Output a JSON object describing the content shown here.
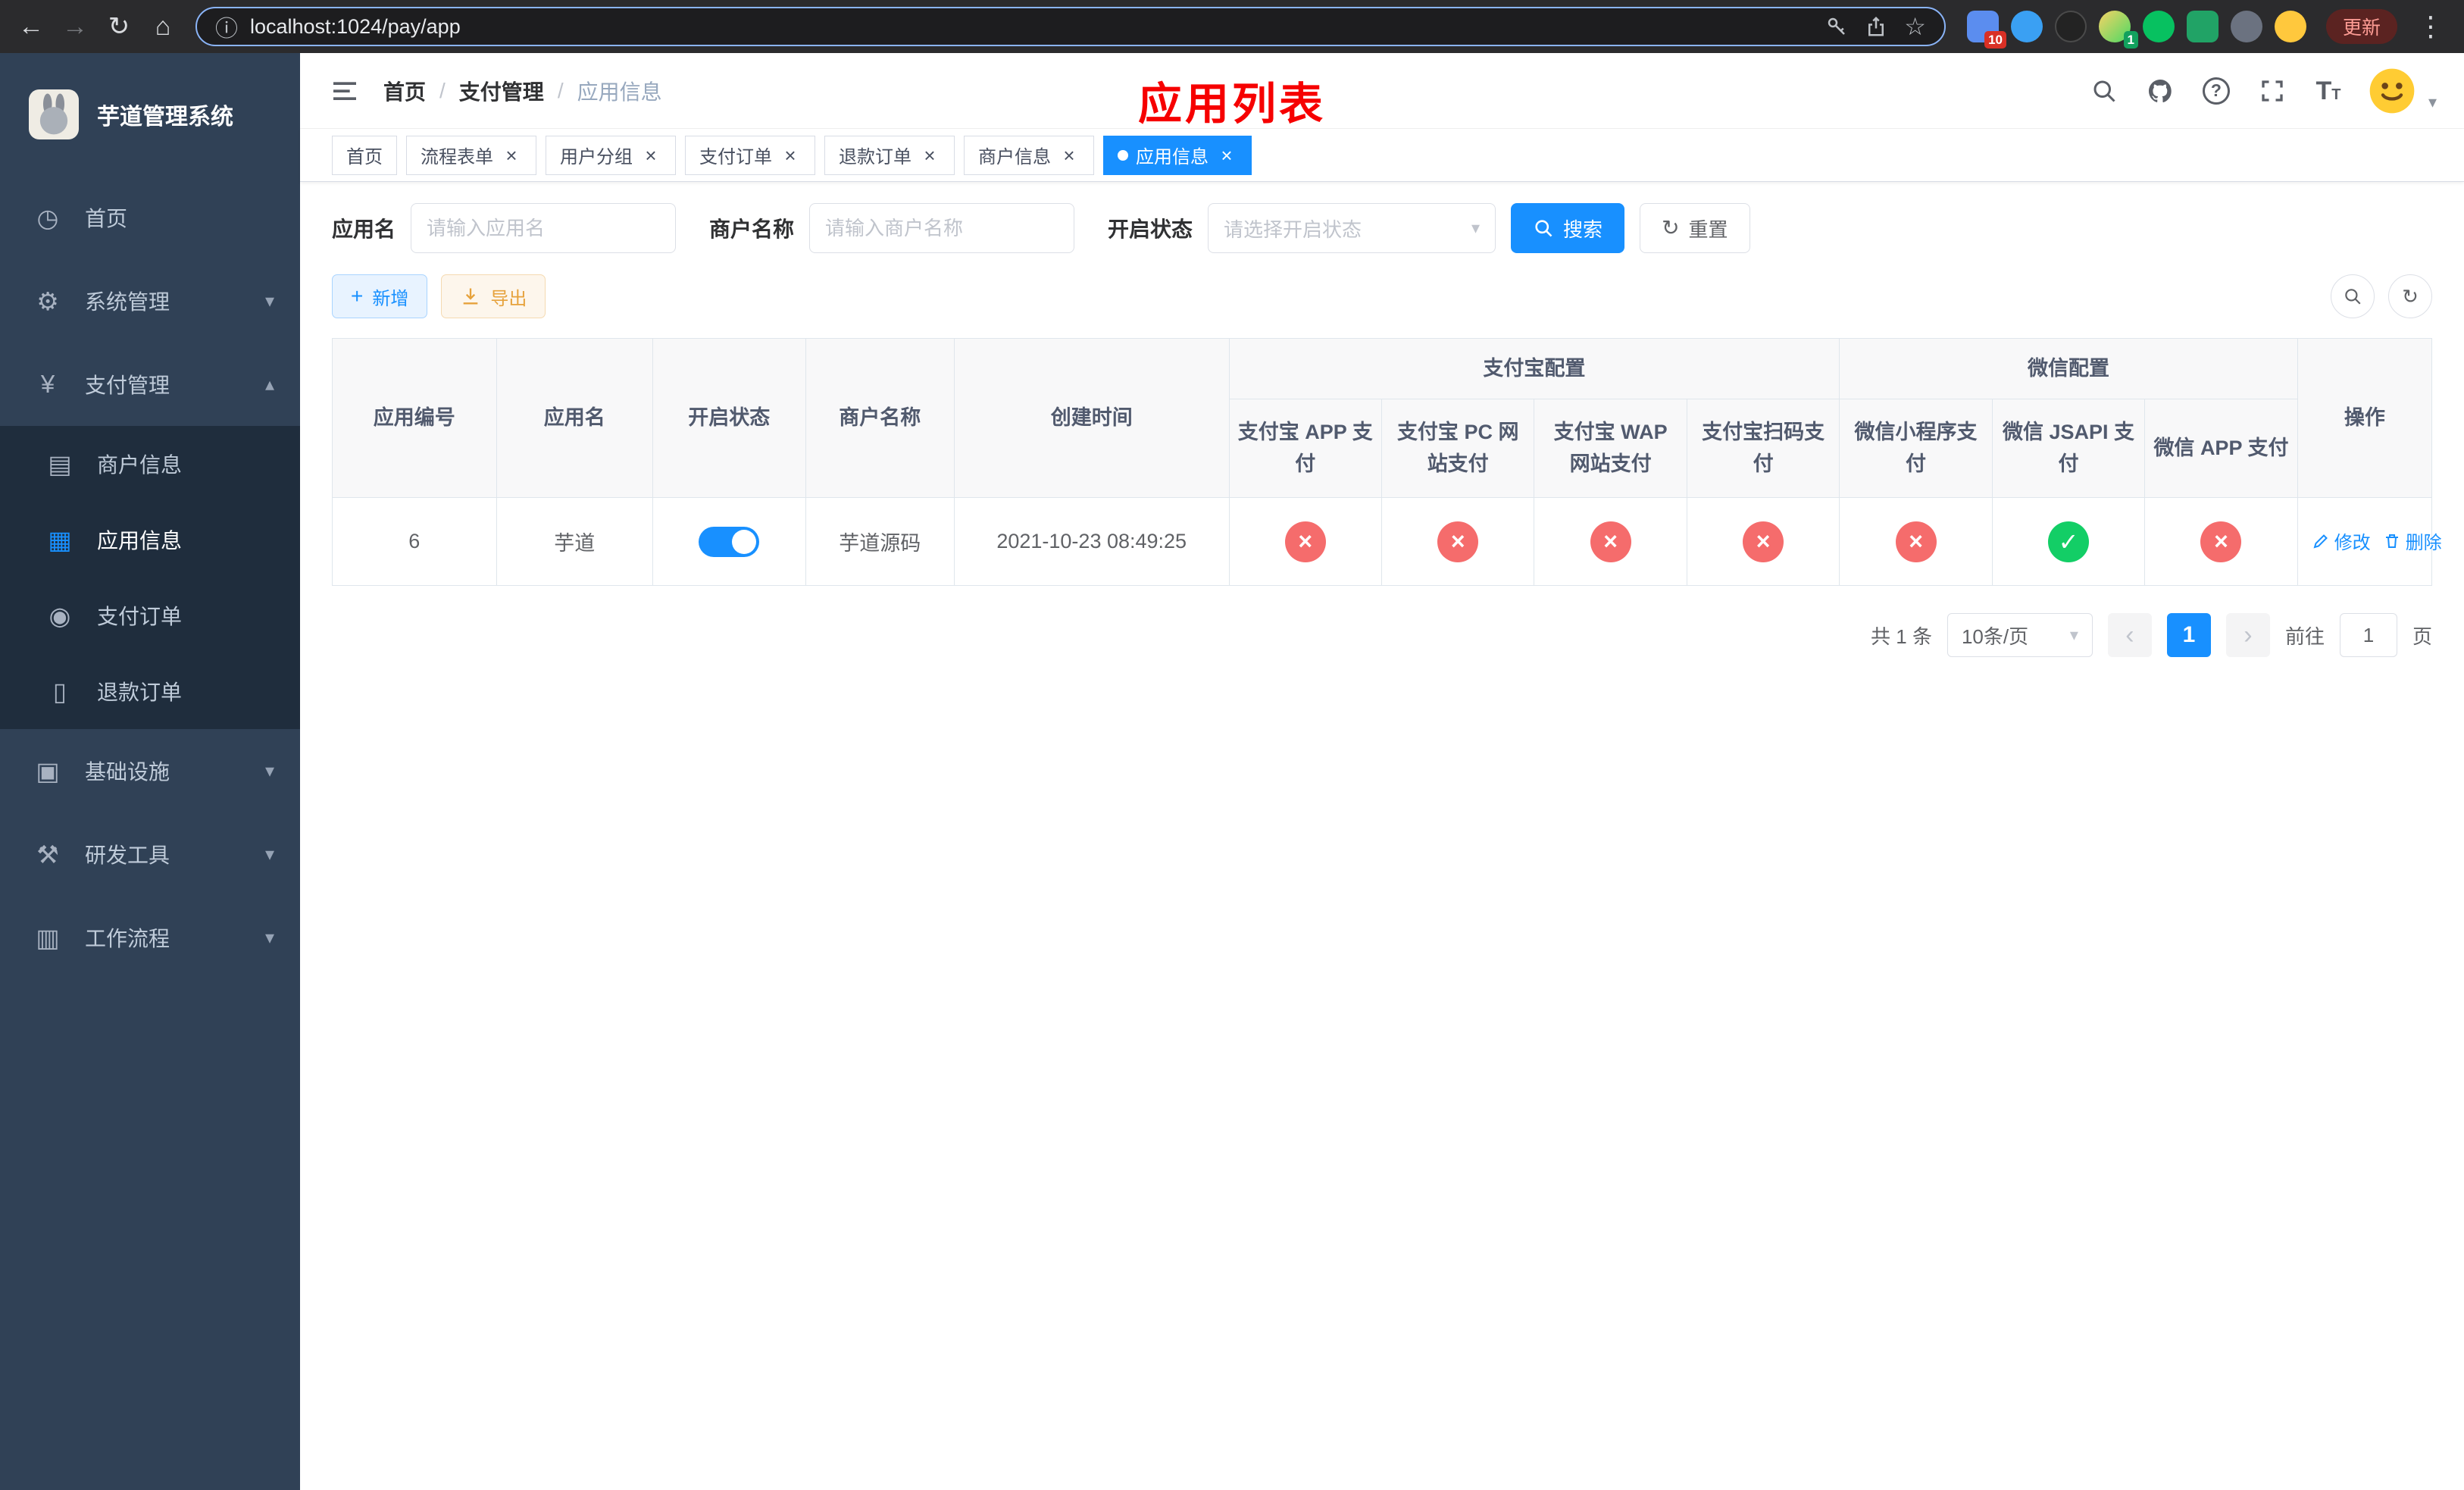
{
  "browser": {
    "url": "localhost:1024/pay/app",
    "update_label": "更新",
    "ext_badge_a": "10",
    "ext_badge_b": "1"
  },
  "sidebar": {
    "title": "芋道管理系统",
    "menu": [
      {
        "label": "首页",
        "icon": "dashboard-icon"
      },
      {
        "label": "系统管理",
        "icon": "gear-icon"
      },
      {
        "label": "支付管理",
        "icon": "yen-icon"
      },
      {
        "label": "基础设施",
        "icon": "infrastructure-icon"
      },
      {
        "label": "研发工具",
        "icon": "devtools-icon"
      },
      {
        "label": "工作流程",
        "icon": "workflow-icon"
      }
    ],
    "submenu": [
      {
        "label": "商户信息",
        "icon": "merchant-card-icon"
      },
      {
        "label": "应用信息",
        "icon": "app-grid-icon"
      },
      {
        "label": "支付订单",
        "icon": "pay-order-icon"
      },
      {
        "label": "退款订单",
        "icon": "refund-doc-icon"
      }
    ]
  },
  "header": {
    "breadcrumb": [
      "首页",
      "支付管理",
      "应用信息"
    ],
    "annotation": "应用列表"
  },
  "tabs": [
    {
      "label": "首页"
    },
    {
      "label": "流程表单"
    },
    {
      "label": "用户分组"
    },
    {
      "label": "支付订单"
    },
    {
      "label": "退款订单"
    },
    {
      "label": "商户信息"
    },
    {
      "label": "应用信息"
    }
  ],
  "filter": {
    "app_name_label": "应用名",
    "app_name_placeholder": "请输入应用名",
    "merchant_label": "商户名称",
    "merchant_placeholder": "请输入商户名称",
    "status_label": "开启状态",
    "status_placeholder": "请选择开启状态",
    "search_label": "搜索",
    "reset_label": "重置"
  },
  "toolbar": {
    "add_label": "新增",
    "export_label": "导出"
  },
  "table": {
    "col_id": "应用编号",
    "col_name": "应用名",
    "col_status": "开启状态",
    "col_merchant": "商户名称",
    "col_created": "创建时间",
    "group_alipay": "支付宝配置",
    "group_wechat": "微信配置",
    "col_alipay_app": "支付宝 APP 支付",
    "col_alipay_pc": "支付宝 PC 网站支付",
    "col_alipay_wap": "支付宝 WAP 网站支付",
    "col_alipay_qr": "支付宝扫码支付",
    "col_wechat_mini": "微信小程序支付",
    "col_wechat_jsapi": "微信 JSAPI 支付",
    "col_wechat_app": "微信 APP 支付",
    "col_actions": "操作",
    "row": {
      "id": "6",
      "name": "芋道",
      "status": "on",
      "merchant": "芋道源码",
      "created": "2021-10-23 08:49:25",
      "configs": [
        "no",
        "no",
        "no",
        "no",
        "no",
        "yes",
        "no"
      ],
      "edit_label": "修改",
      "delete_label": "删除"
    }
  },
  "pagination": {
    "total_label": "共 1 条",
    "page_size": "10条/页",
    "current_page": "1",
    "goto_label": "前往",
    "goto_value": "1",
    "goto_unit": "页"
  },
  "colors": {
    "primary": "#1890ff",
    "success": "#13ce66",
    "danger": "#f56c6c",
    "warning": "#e6a23c",
    "sidebar_bg": "#304156",
    "submenu_bg": "#1f2d3d",
    "annotation_red": "#f60000"
  }
}
